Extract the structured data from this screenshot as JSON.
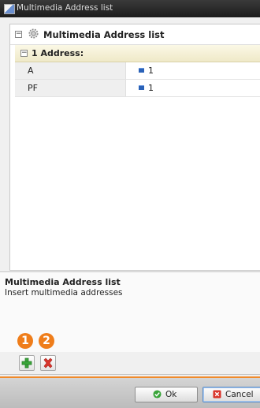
{
  "window": {
    "title": "Multimedia Address list"
  },
  "tree": {
    "header_label": "Multimedia Address list",
    "section_label": "1 Address:",
    "rows": [
      {
        "key": "A",
        "value": "1"
      },
      {
        "key": "PF",
        "value": "1"
      }
    ]
  },
  "description": {
    "title": "Multimedia Address list",
    "text": "Insert multimedia addresses"
  },
  "badges": [
    "1",
    "2"
  ],
  "toolbar": {
    "add_icon": "plus-icon",
    "delete_icon": "x-icon"
  },
  "footer": {
    "ok_label": "Ok",
    "cancel_label": "Cancel"
  },
  "colors": {
    "accent": "#f08a2a",
    "badge": "#ef7d1a",
    "add": "#3aa53a",
    "delete": "#d9352b"
  }
}
